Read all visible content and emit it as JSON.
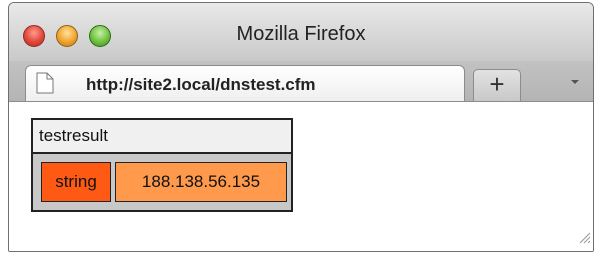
{
  "window": {
    "title": "Mozilla Firefox"
  },
  "tabs": [
    {
      "label": "http://site2.local/dnstest.cfm",
      "icon": "page-icon",
      "active": true
    }
  ],
  "toolbar": {
    "new_tab_label": "+",
    "tab_menu_icon": "chevron-down-icon"
  },
  "dump": {
    "header": "testresult",
    "type": "string",
    "value": "188.138.56.135"
  },
  "colors": {
    "type_cell": "#ff5a14",
    "value_cell": "#ff9a4d",
    "dump_frame": "#c8c8c8"
  }
}
